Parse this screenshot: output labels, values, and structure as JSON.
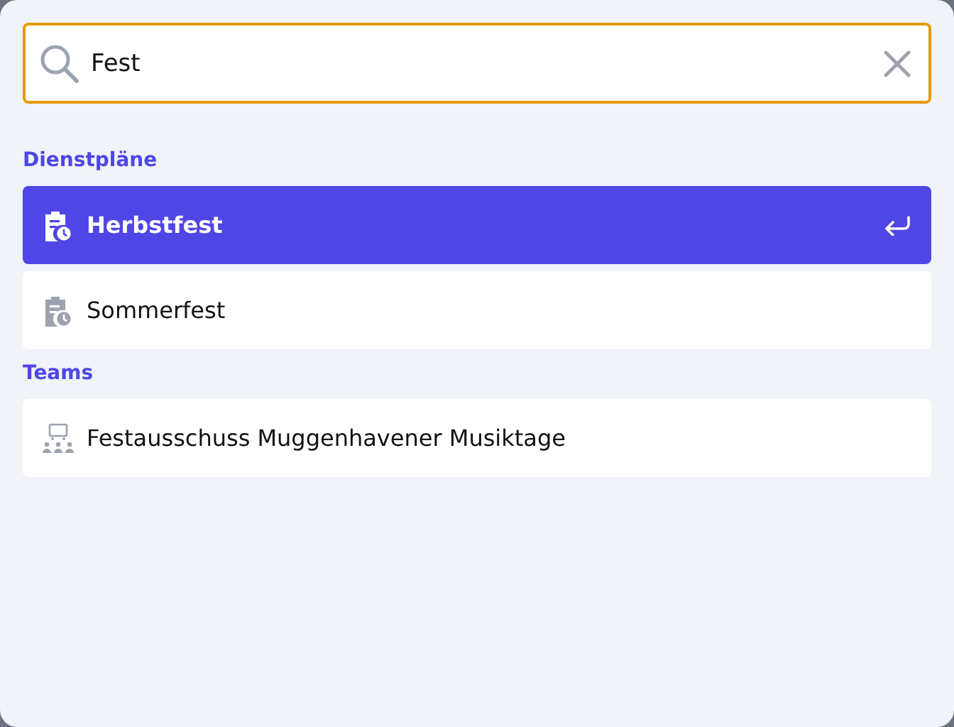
{
  "search": {
    "value": "Fest"
  },
  "groups": [
    {
      "title": "Dienstpläne",
      "items": [
        {
          "kind": "schedule",
          "label": "Herbstfest",
          "selected": true
        },
        {
          "kind": "schedule",
          "label": "Sommerfest",
          "selected": false
        }
      ]
    },
    {
      "title": "Teams",
      "items": [
        {
          "kind": "team",
          "label": "Festausschuss Muggenhavener Musiktage",
          "selected": false
        }
      ]
    }
  ]
}
